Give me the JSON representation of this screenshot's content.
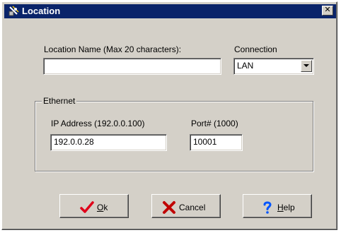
{
  "window": {
    "title": "Location",
    "close_glyph": "✕"
  },
  "location_name": {
    "label": "Location Name (Max 20 characters):",
    "value": ""
  },
  "connection": {
    "label": "Connection",
    "selected": "LAN"
  },
  "ethernet": {
    "group_label": "Ethernet",
    "ip": {
      "label": "IP Address (192.0.0.100)",
      "value": "192.0.0.28"
    },
    "port": {
      "label": "Port# (1000)",
      "value": "10001"
    }
  },
  "buttons": {
    "ok": {
      "mnemonic": "O",
      "rest": "k",
      "icon": "checkmark-icon"
    },
    "cancel": {
      "label": "Cancel",
      "icon": "x-icon"
    },
    "help": {
      "mnemonic": "H",
      "rest": "elp",
      "icon": "question-mark-icon"
    }
  },
  "colors": {
    "titlebar": "#0a246a",
    "face": "#d4d0c8",
    "ok_icon": "#e0001a",
    "cancel_icon": "#c00000",
    "help_icon": "#0055ff"
  }
}
